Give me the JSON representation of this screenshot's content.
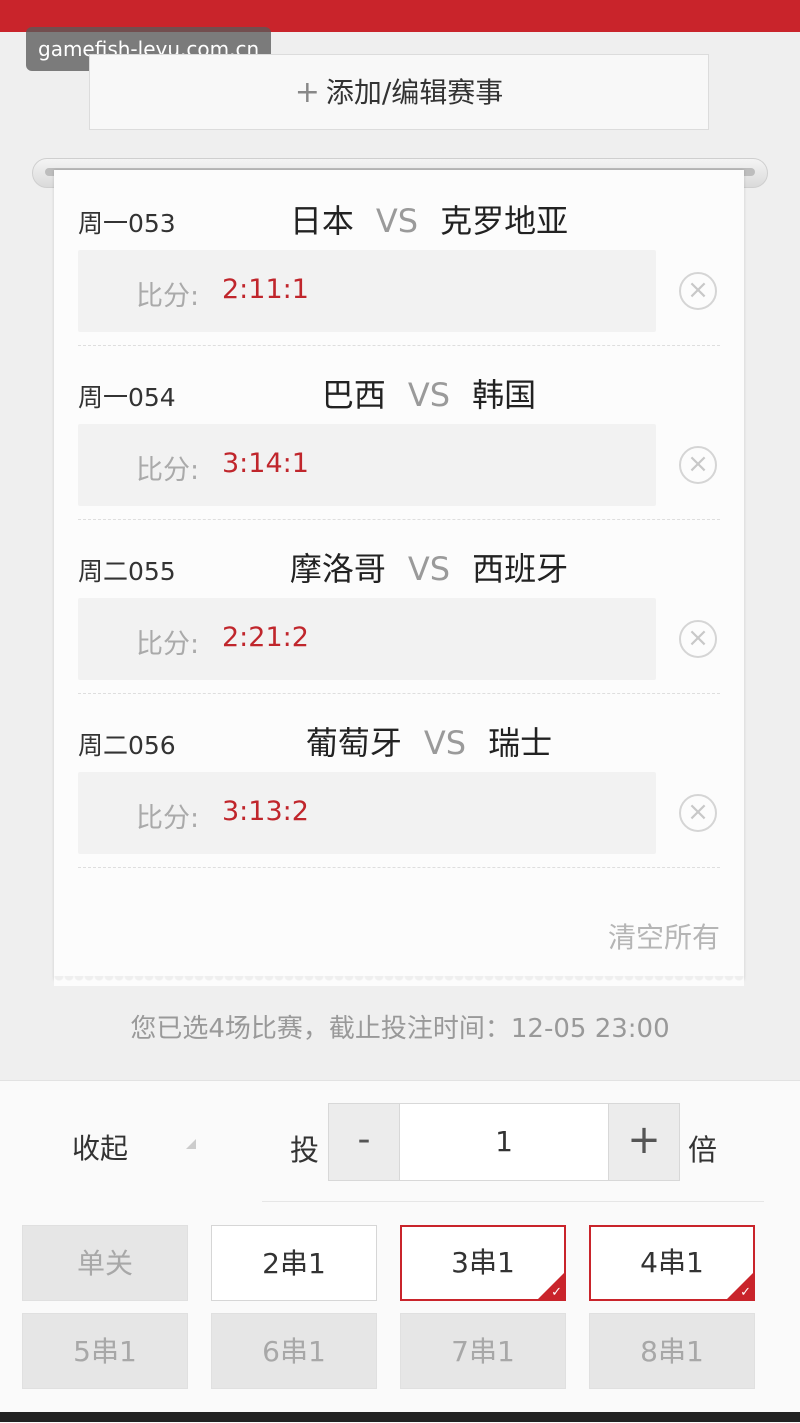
{
  "watermark": "gamefish-leyu.com.cn",
  "add_button": {
    "icon": "plus-icon",
    "label": "添加/编辑赛事"
  },
  "matches": [
    {
      "code": "周一053",
      "home": "日本",
      "vs": "VS",
      "away": "克罗地亚",
      "score_label": "比分:",
      "score": "2:11:1"
    },
    {
      "code": "周一054",
      "home": "巴西",
      "vs": "VS",
      "away": "韩国",
      "score_label": "比分:",
      "score": "3:14:1"
    },
    {
      "code": "周二055",
      "home": "摩洛哥",
      "vs": "VS",
      "away": "西班牙",
      "score_label": "比分:",
      "score": "2:21:2"
    },
    {
      "code": "周二056",
      "home": "葡萄牙",
      "vs": "VS",
      "away": "瑞士",
      "score_label": "比分:",
      "score": "3:13:2"
    }
  ],
  "clear_all": "清空所有",
  "summary": "您已选4场比赛，截止投注时间：12-05 23:00",
  "controls": {
    "collapse": "收起",
    "bet": "投",
    "minus": "-",
    "quantity": "1",
    "plus": "+",
    "multiplier": "倍"
  },
  "combos": [
    {
      "label": "单关",
      "state": "disabled"
    },
    {
      "label": "2串1",
      "state": "normal"
    },
    {
      "label": "3串1",
      "state": "selected"
    },
    {
      "label": "4串1",
      "state": "selected"
    },
    {
      "label": "5串1",
      "state": "disabled"
    },
    {
      "label": "6串1",
      "state": "disabled"
    },
    {
      "label": "7串1",
      "state": "disabled"
    },
    {
      "label": "8串1",
      "state": "disabled"
    }
  ],
  "colors": {
    "brand_red": "#c9242b",
    "score_red": "#c0262c"
  }
}
